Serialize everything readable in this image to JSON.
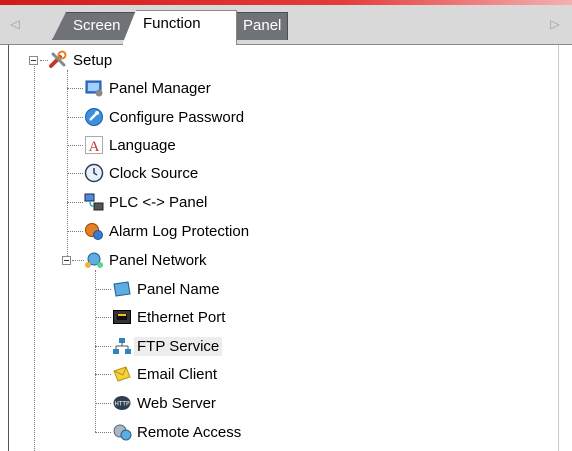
{
  "tabs": [
    {
      "label": "Screen",
      "active": false
    },
    {
      "label": "Function",
      "active": true
    },
    {
      "label": "Panel",
      "active": false
    }
  ],
  "tree": {
    "root": {
      "label": "Setup",
      "icon": "tools-icon"
    },
    "children": [
      {
        "label": "Panel Manager",
        "icon": "panel-manager-icon"
      },
      {
        "label": "Configure Password",
        "icon": "password-icon"
      },
      {
        "label": "Language",
        "icon": "language-icon"
      },
      {
        "label": "Clock Source",
        "icon": "clock-icon"
      },
      {
        "label": "PLC <-> Panel",
        "icon": "plc-panel-icon"
      },
      {
        "label": "Alarm Log Protection",
        "icon": "alarm-log-icon"
      },
      {
        "label": "Panel Network",
        "icon": "network-icon"
      }
    ],
    "network_children": [
      {
        "label": "Panel Name",
        "icon": "panel-name-icon"
      },
      {
        "label": "Ethernet Port",
        "icon": "ethernet-icon"
      },
      {
        "label": "FTP Service",
        "icon": "ftp-icon",
        "selected": true
      },
      {
        "label": "Email Client",
        "icon": "email-icon"
      },
      {
        "label": "Web Server",
        "icon": "web-server-icon"
      },
      {
        "label": "Remote Access",
        "icon": "remote-access-icon"
      }
    ]
  }
}
